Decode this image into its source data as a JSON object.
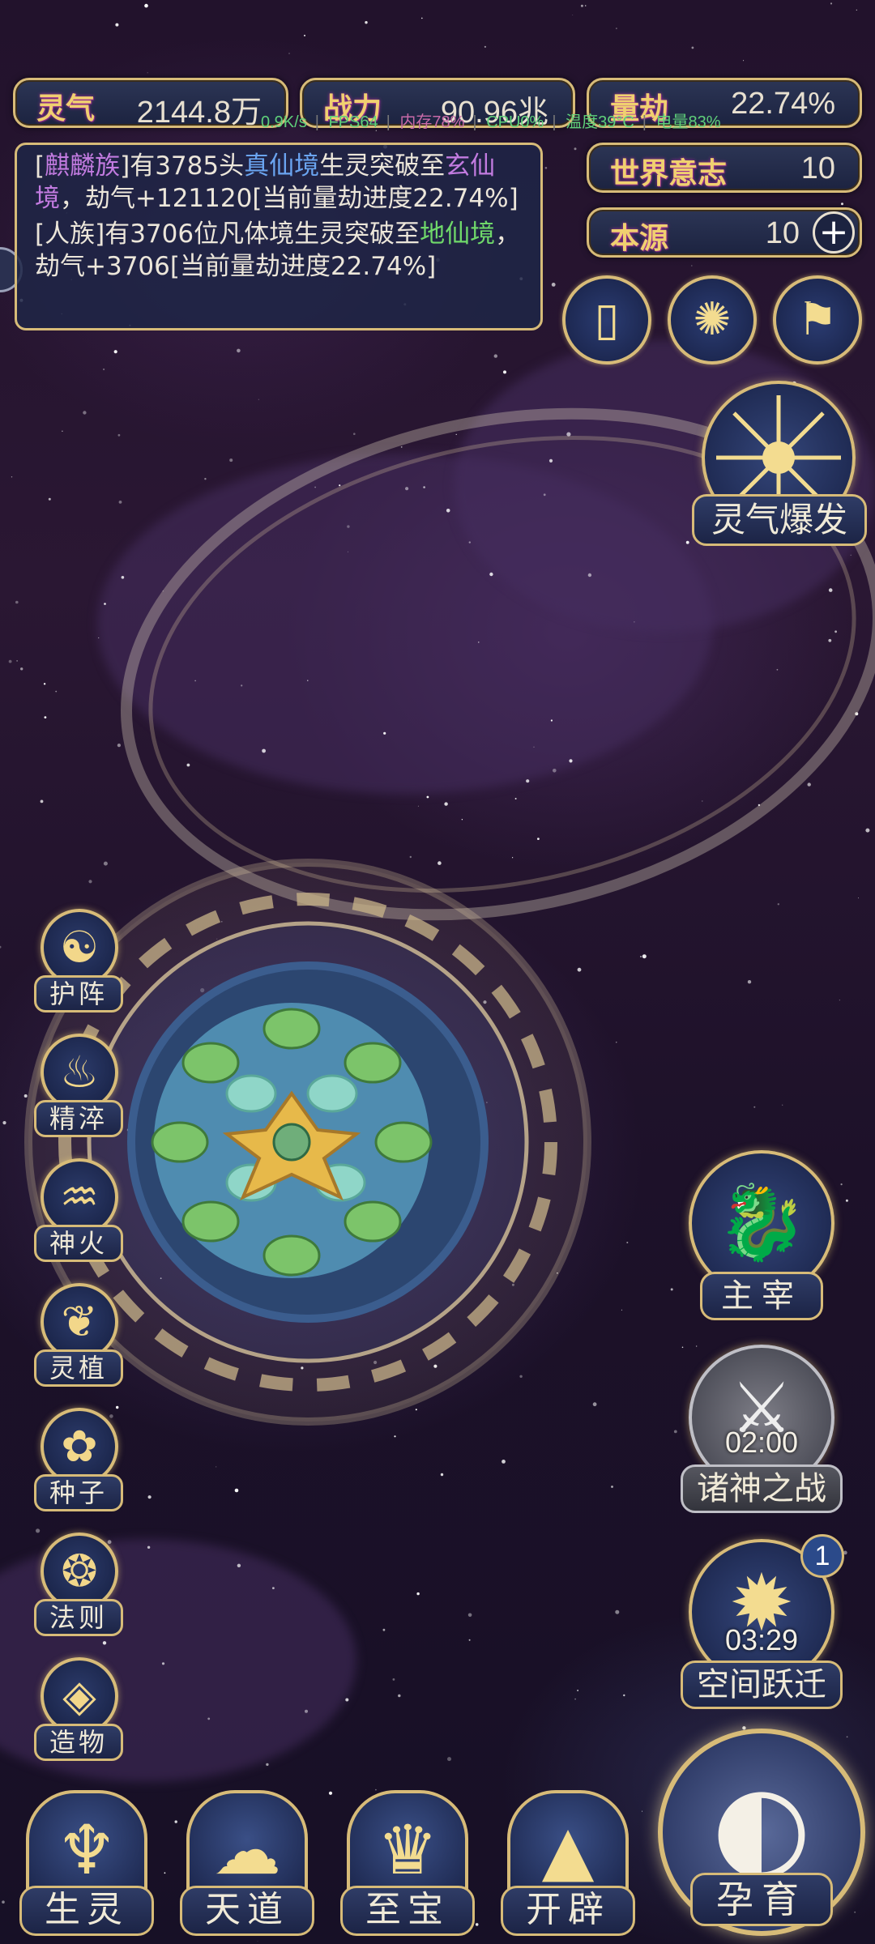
{
  "resources": {
    "lingqi": {
      "label": "灵气",
      "value": "2144.8万"
    },
    "zhanli": {
      "label": "战力",
      "value": "90.96兆"
    },
    "liangjie": {
      "label": "量劫",
      "value": "22.74%"
    },
    "shijie": {
      "label": "世界意志",
      "value": "10"
    },
    "benyuan": {
      "label": "本源",
      "value": "10"
    }
  },
  "status_bar": {
    "signal": "0.9K/s",
    "fps": "FPS64",
    "memory": "内存78%",
    "cpu": "CPU0%",
    "temp": "温度39°C",
    "battery": "电量83%"
  },
  "log": [
    {
      "p1": "[",
      "race": "麒麟族",
      "p2": "]有3785头",
      "realm1": "真仙境",
      "p3": "生灵突破至",
      "realm2": "玄仙境",
      "p4": "，劫气+121120[当前量劫进度22.74%]"
    },
    {
      "p1": "[人族]有3706位凡体境生灵突破至",
      "realm2": "地仙境",
      "p4": "，劫气+3706[当前量劫进度22.74%]"
    }
  ],
  "top_icons": [
    {
      "name": "scroll-icon",
      "glyph": "▯"
    },
    {
      "name": "vortex-icon",
      "glyph": "✺"
    },
    {
      "name": "flag-icon",
      "glyph": "⚑"
    }
  ],
  "burst": {
    "label": "灵气爆发",
    "icon": "burst-icon"
  },
  "side_menu": [
    {
      "label": "护阵",
      "icon": "taiji-icon",
      "glyph": "☯"
    },
    {
      "label": "精淬",
      "icon": "lotus-flame-icon",
      "glyph": "♨"
    },
    {
      "label": "神火",
      "icon": "fire-icon",
      "glyph": "♒"
    },
    {
      "label": "灵植",
      "icon": "plant-icon",
      "glyph": "❦"
    },
    {
      "label": "种子",
      "icon": "seed-flower-icon",
      "glyph": "✿"
    },
    {
      "label": "法则",
      "icon": "rule-icon",
      "glyph": "❂"
    },
    {
      "label": "造物",
      "icon": "creation-icon",
      "glyph": "◈"
    }
  ],
  "right_menu": {
    "zhuzai": {
      "label": "主宰",
      "icon": "dragon-icon",
      "glyph": "🐉"
    },
    "zhushen": {
      "label": "诸神之战",
      "timer": "02:00",
      "icon": "sword-icon",
      "glyph": "⚔"
    },
    "kongjian": {
      "label": "空间跃迁",
      "timer": "03:29",
      "badge": "1",
      "icon": "portal-icon",
      "glyph": "✹"
    }
  },
  "bottom_nav": [
    {
      "label": "生灵",
      "icon": "phoenix-icon",
      "glyph": "♆"
    },
    {
      "label": "天道",
      "icon": "cloud-swirl-icon",
      "glyph": "☁"
    },
    {
      "label": "至宝",
      "icon": "treasure-icon",
      "glyph": "♛"
    },
    {
      "label": "开辟",
      "icon": "mountain-icon",
      "glyph": "▲"
    }
  ],
  "yunyu": {
    "label": "孕育",
    "icon": "embryo-icon",
    "glyph": "◐"
  },
  "plus_icon": "plus-icon",
  "colors": {
    "gold": "#d7bb78",
    "panel": "#1c2340",
    "sky": "#22122c"
  }
}
